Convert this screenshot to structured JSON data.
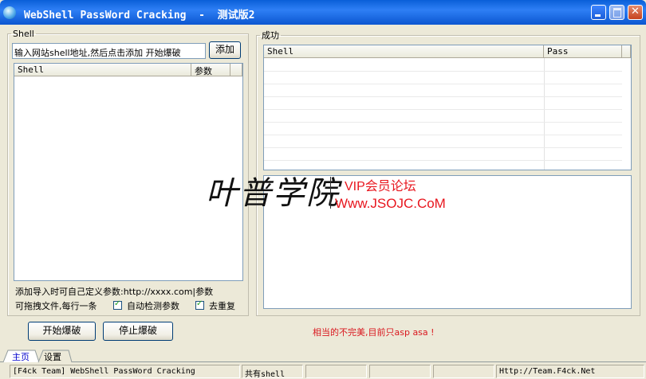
{
  "window": {
    "title": "WebShell PassWord Cracking  -  测试版2",
    "close_label": "✕"
  },
  "left_panel": {
    "legend": "Shell",
    "url_input": {
      "value": "输入网站shell地址,然后点击添加 开始爆破"
    },
    "add_button": "添加",
    "list": {
      "columns": [
        "Shell",
        "参数"
      ],
      "rows": []
    },
    "hint_line1": "添加导入时可自己定义参数:http://xxxx.com|参数",
    "hint_line2": "可拖拽文件,每行一条",
    "auto_detect": {
      "label": "自动检测参数",
      "checked": true
    },
    "dedupe": {
      "label": "去重复",
      "checked": true
    }
  },
  "right_panel": {
    "legend": "成功",
    "success_list": {
      "columns": [
        "Shell",
        "Pass"
      ],
      "rows": []
    }
  },
  "watermark": {
    "chinese": "叶普学院",
    "line1": "VIP会员论坛",
    "line2": "Www.JSOJC.CoM"
  },
  "bottom": {
    "start_button": "开始爆破",
    "stop_button": "停止爆破",
    "warning": "相当的不完美,目前只asp asa !"
  },
  "tabs": [
    {
      "label": "主页",
      "active": true
    },
    {
      "label": "设置",
      "active": false
    }
  ],
  "status": {
    "team": "[F4ck Team] WebShell PassWord Cracking",
    "count_label": "共有shell",
    "cell3": "",
    "cell4": "",
    "cell5": "",
    "url": "Http://Team.F4ck.Net"
  },
  "colors": {
    "title_bar": "#0a5fd8",
    "warning": "#d9171e",
    "watermark_red": "#e8161e",
    "active_tab": "#0000cc"
  }
}
